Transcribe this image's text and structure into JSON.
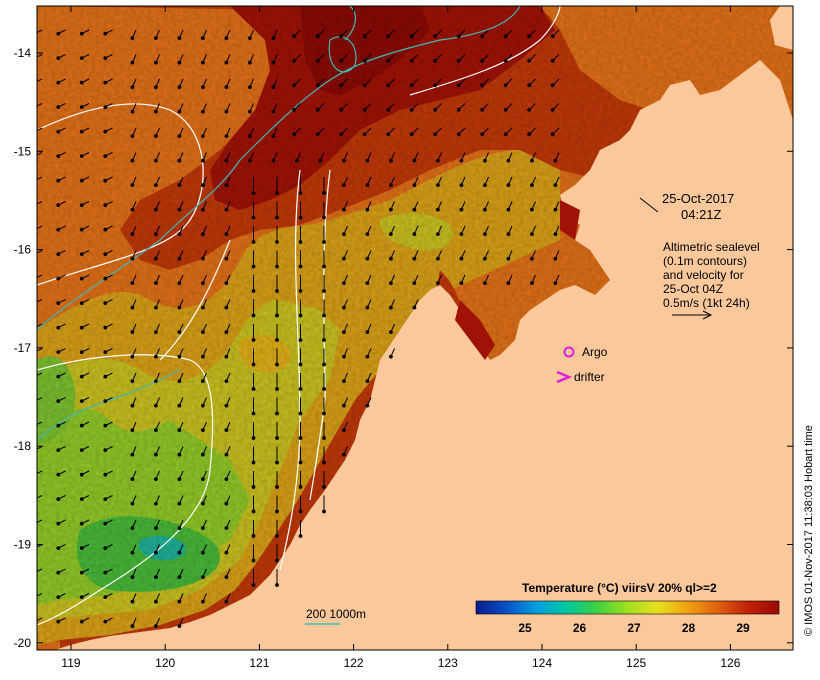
{
  "map": {
    "lon_ticks": [
      "119",
      "120",
      "121",
      "122",
      "123",
      "124",
      "125",
      "126"
    ],
    "lat_ticks": [
      "-14",
      "-15",
      "-16",
      "-17",
      "-18",
      "-19",
      "-20"
    ],
    "date_label": "25-Oct-2017",
    "time_label": "04:21Z",
    "altimetry_note": [
      "Altimetric sealevel",
      "(0.1m contours)",
      "and velocity for",
      "25-Oct 04Z",
      "0.5m/s (1kt 24h)"
    ],
    "legend_argo": "Argo",
    "legend_drifter": "drifter",
    "depth_contours_label": "200  1000m",
    "colorbar": {
      "title": "Temperature (°C) viirsV 20% ql>=2",
      "ticks": [
        "25",
        "26",
        "27",
        "28",
        "29"
      ],
      "colors": [
        "#0b1a8c",
        "#0a50c8",
        "#00a0e0",
        "#00c8a0",
        "#40d040",
        "#a0e020",
        "#e8e020",
        "#f0a010",
        "#e06010",
        "#c02008",
        "#9a0a05"
      ]
    },
    "credit": "© IMOS 01-Nov-2017 11:38:03 Hobart time",
    "colors": {
      "land": "#fbc89c",
      "warm_water": "#a01205",
      "mid_water": "#e07018",
      "cool_water": "#d8c828",
      "cold_water": "#48b838",
      "contour_white": "#ffffff",
      "contour_teal": "#40b8b0",
      "argo": "#e020e0",
      "drifter": "#e020e0"
    }
  }
}
